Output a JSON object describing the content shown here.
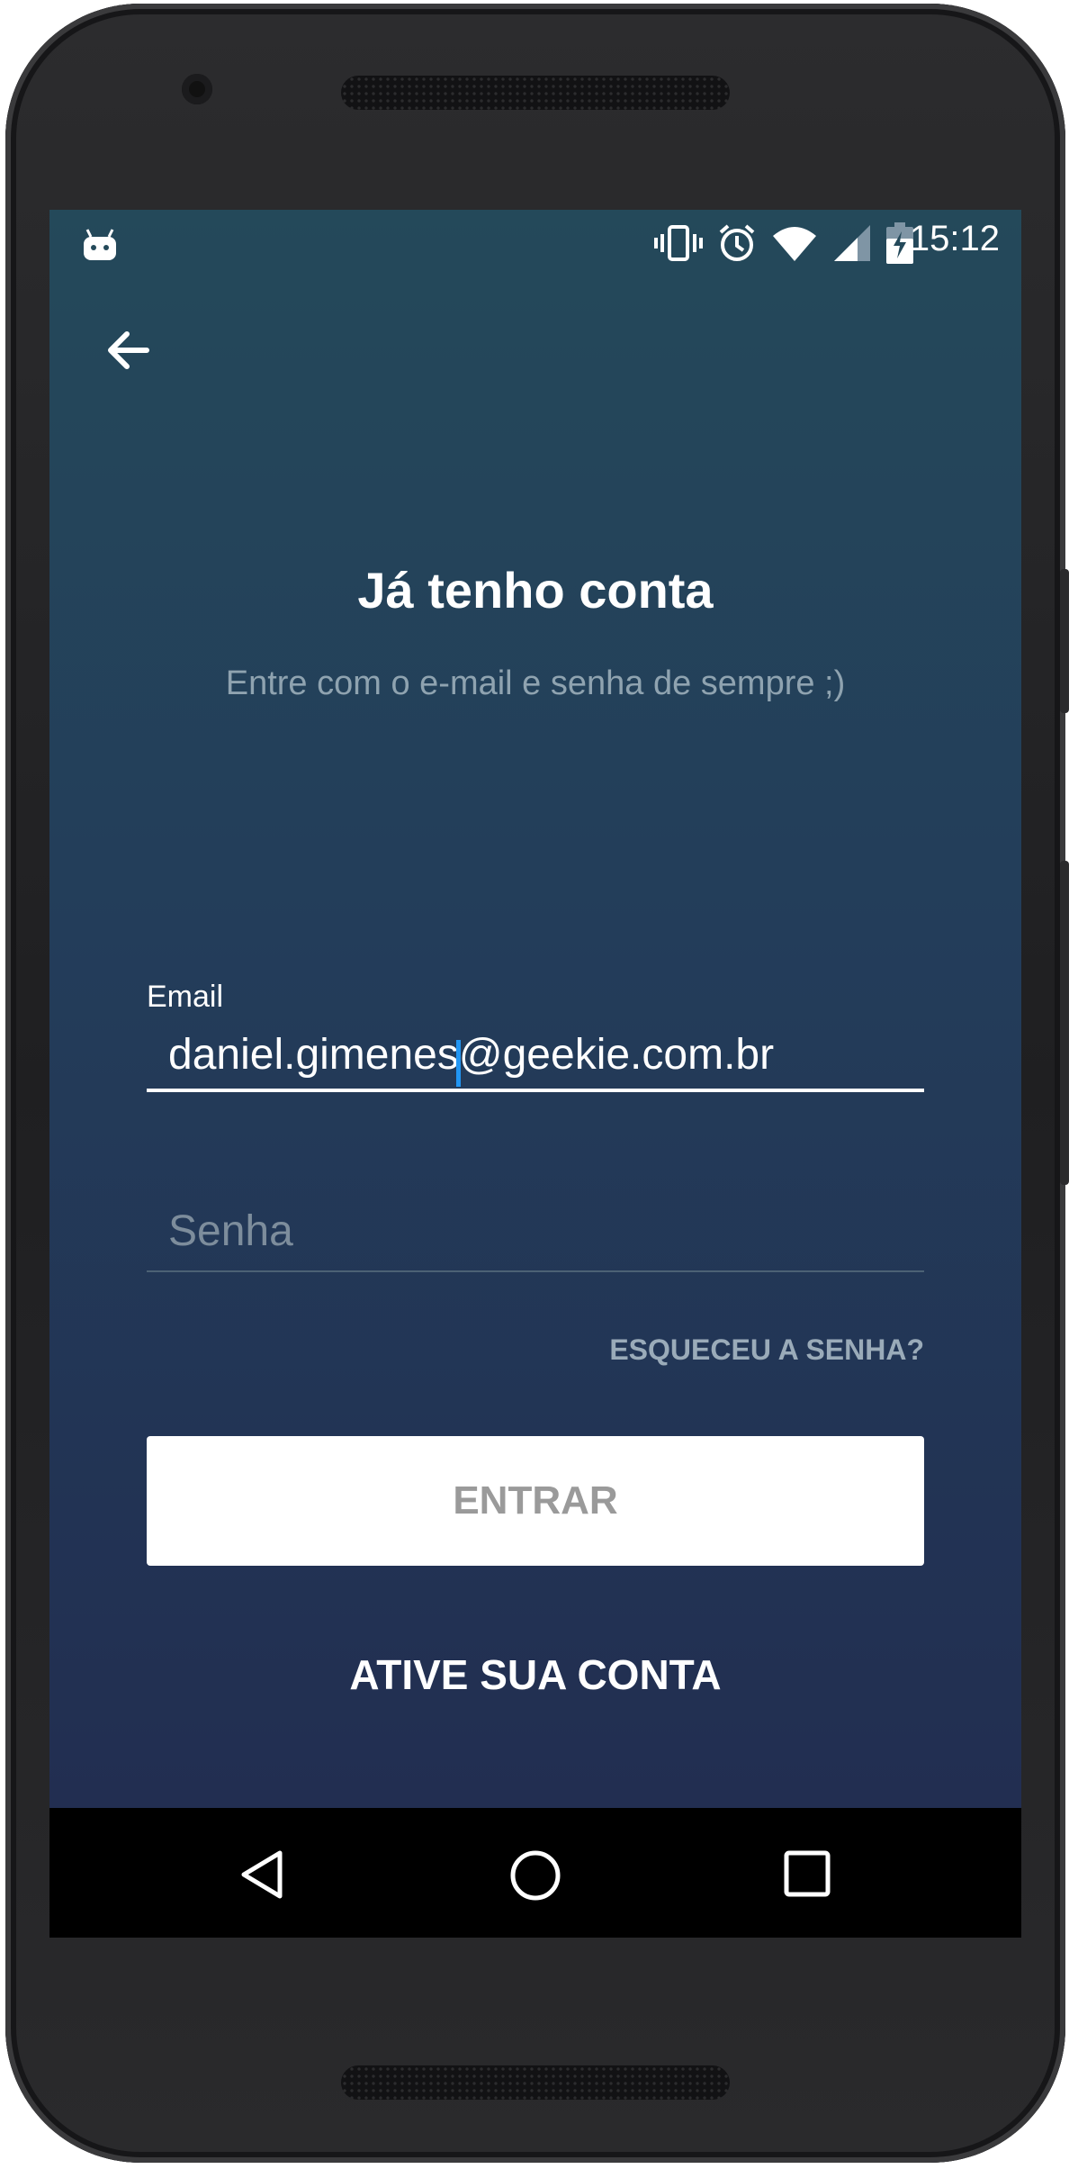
{
  "status_bar": {
    "time": "15:12",
    "icons": [
      "android-debug-icon",
      "vibrate-icon",
      "alarm-icon",
      "wifi-icon",
      "signal-icon",
      "battery-charging-icon"
    ]
  },
  "header": {
    "back_icon": "arrow-left-icon"
  },
  "login": {
    "title": "Já tenho conta",
    "subtitle": "Entre com o e-mail e senha de sempre ;)",
    "email_label": "Email",
    "email_value": "daniel.gimenes@geekie.com.br",
    "password_placeholder": "Senha",
    "forgot_label": "ESQUECEU A SENHA?",
    "submit_label": "ENTRAR",
    "activate_label": "ATIVE SUA CONTA"
  },
  "nav_bar": {
    "icons": [
      "back-triangle-icon",
      "home-circle-icon",
      "recents-square-icon"
    ]
  },
  "colors": {
    "accent": "#2196f3",
    "background_top": "#24495a",
    "background_bottom": "#222e51"
  }
}
